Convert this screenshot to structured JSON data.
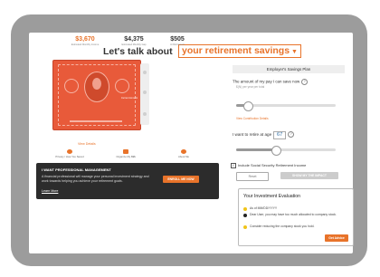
{
  "header": {
    "title": "Let's talk about",
    "select_value": "your retirement savings"
  },
  "stats": [
    {
      "value": "$3,670",
      "label": "Estimated Monthly Income"
    },
    {
      "value": "$4,375",
      "label": "Estimated Monthly Gap"
    },
    {
      "value": "$505",
      "label": "At Retirement"
    }
  ],
  "bill": {
    "label": "Current Amount"
  },
  "links": {
    "view_details": "View Details",
    "view_contribution": "View Contribution Details"
  },
  "icon_links": [
    {
      "icon": "lock-icon",
      "label": "Privacy / How You Saved"
    },
    {
      "icon": "envelope-icon",
      "label": "Organize My $$$"
    },
    {
      "icon": "person-icon",
      "label": "About Me"
    }
  ],
  "promo": {
    "title": "I WANT PROFESSIONAL MANAGEMENT",
    "body": "A financial professional will manage your personal investment strategy and work towards helping you achieve your retirement goals.",
    "link": "Learn More",
    "button": "ENROLL ME NOW"
  },
  "plan": {
    "title": "Employer's Savings Plan",
    "amount_label": "The amount of my pay I can save now",
    "amount_hint": "$(N) per year per total",
    "amount_level": 0.12,
    "retire_label": "I want to retire at age",
    "retire_age": "67",
    "retire_level": 0.4,
    "ss_label": "Include Social Security Retirement Income",
    "ss_checked": "✓",
    "reset_button": "Reset",
    "apply_button": "SHOW MY THE IMPACT"
  },
  "evaluation": {
    "title": "Your Investment Evaluation",
    "rows": [
      "As of MM/DD/YYYY",
      "Dear User, you may have too much allocated to company stock.",
      "Consider reducing the company stock you hold."
    ],
    "button": "Get Advice",
    "colors": {
      "yellow": "#f0c419",
      "black": "#222222"
    }
  },
  "colors": {
    "accent": "#e8732a",
    "bill": "#e85a3a",
    "frame": "#9c9c9c"
  }
}
